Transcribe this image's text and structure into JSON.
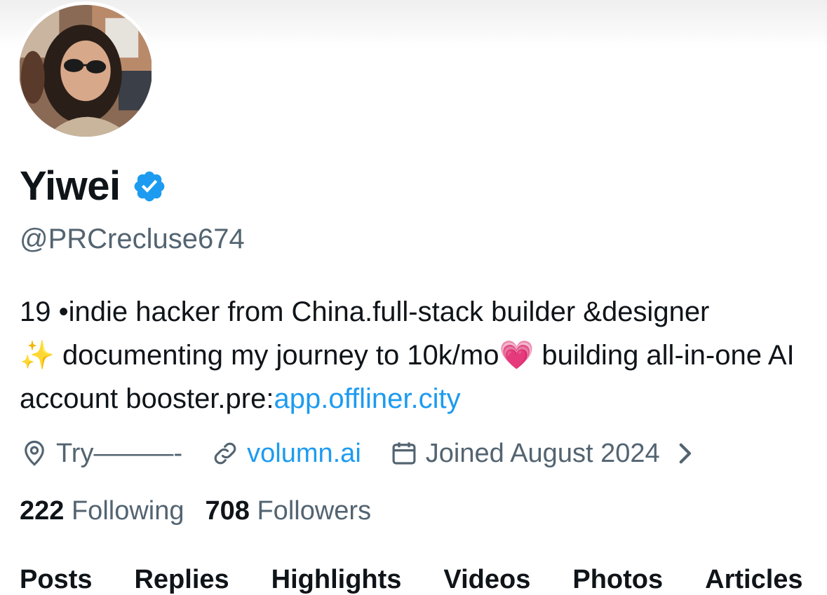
{
  "profile": {
    "name": "Yiwei",
    "handle": "@PRCrecluse674",
    "bio": {
      "line1": "19 •indie hacker from China.full-stack builder &designer",
      "sparkles": "✨",
      "line2a": "documenting my journey to 10k/mo",
      "heart": "💗",
      "line2b": "building all-in-one AI account booster.pre:",
      "link": "app.offliner.city"
    },
    "location": "Try———-",
    "website": "volumn.ai",
    "joined": "Joined August 2024",
    "icons": {
      "verified": "verified-badge-icon",
      "location": "location-pin-icon",
      "website": "link-icon",
      "joined": "calendar-icon",
      "chevron": "chevron-right-icon"
    }
  },
  "stats": {
    "following_count": "222",
    "following_label": "Following",
    "followers_count": "708",
    "followers_label": "Followers"
  },
  "tabs": [
    "Posts",
    "Replies",
    "Highlights",
    "Videos",
    "Photos",
    "Articles"
  ],
  "colors": {
    "accent": "#1d9bf0",
    "secondary_text": "#536471",
    "primary_text": "#0f1419"
  }
}
